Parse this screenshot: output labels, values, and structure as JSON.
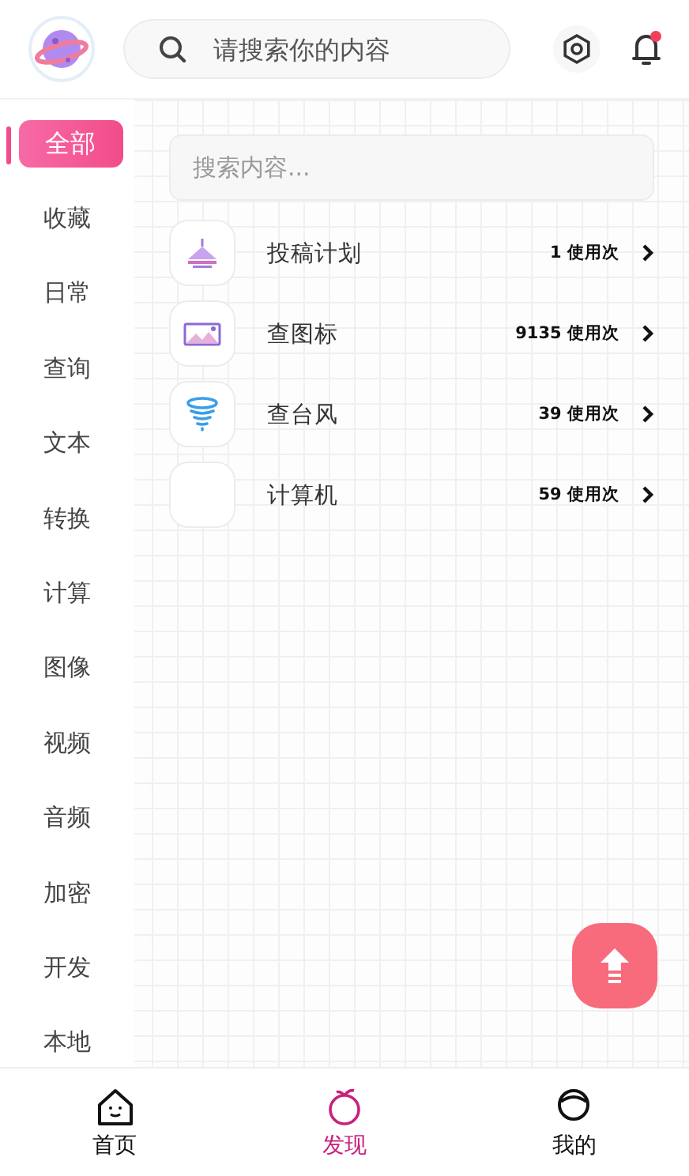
{
  "header": {
    "search": {
      "placeholder": "请搜索你的内容"
    }
  },
  "categories": [
    {
      "label": "全部",
      "selected": true
    },
    {
      "label": "收藏",
      "selected": false
    },
    {
      "label": "日常",
      "selected": false
    },
    {
      "label": "查询",
      "selected": false
    },
    {
      "label": "文本",
      "selected": false
    },
    {
      "label": "转换",
      "selected": false
    },
    {
      "label": "计算",
      "selected": false
    },
    {
      "label": "图像",
      "selected": false
    },
    {
      "label": "视频",
      "selected": false
    },
    {
      "label": "音频",
      "selected": false
    },
    {
      "label": "加密",
      "selected": false
    },
    {
      "label": "开发",
      "selected": false
    },
    {
      "label": "本地",
      "selected": false
    }
  ],
  "content": {
    "search": {
      "placeholder": "搜索内容..."
    },
    "tools": [
      {
        "kind": "plan",
        "name": "投稿计划",
        "usage": "1 使用次"
      },
      {
        "kind": "image",
        "name": "查图标",
        "usage": "9135 使用次"
      },
      {
        "kind": "storm",
        "name": "查台风",
        "usage": "39 使用次"
      },
      {
        "kind": "blank",
        "name": "计算机",
        "usage": "59 使用次"
      }
    ]
  },
  "tab_bar": [
    {
      "kind": "home",
      "label": "首页",
      "selected": false
    },
    {
      "kind": "discover",
      "label": "发现",
      "selected": true
    },
    {
      "kind": "me",
      "label": "我的",
      "selected": false
    }
  ]
}
